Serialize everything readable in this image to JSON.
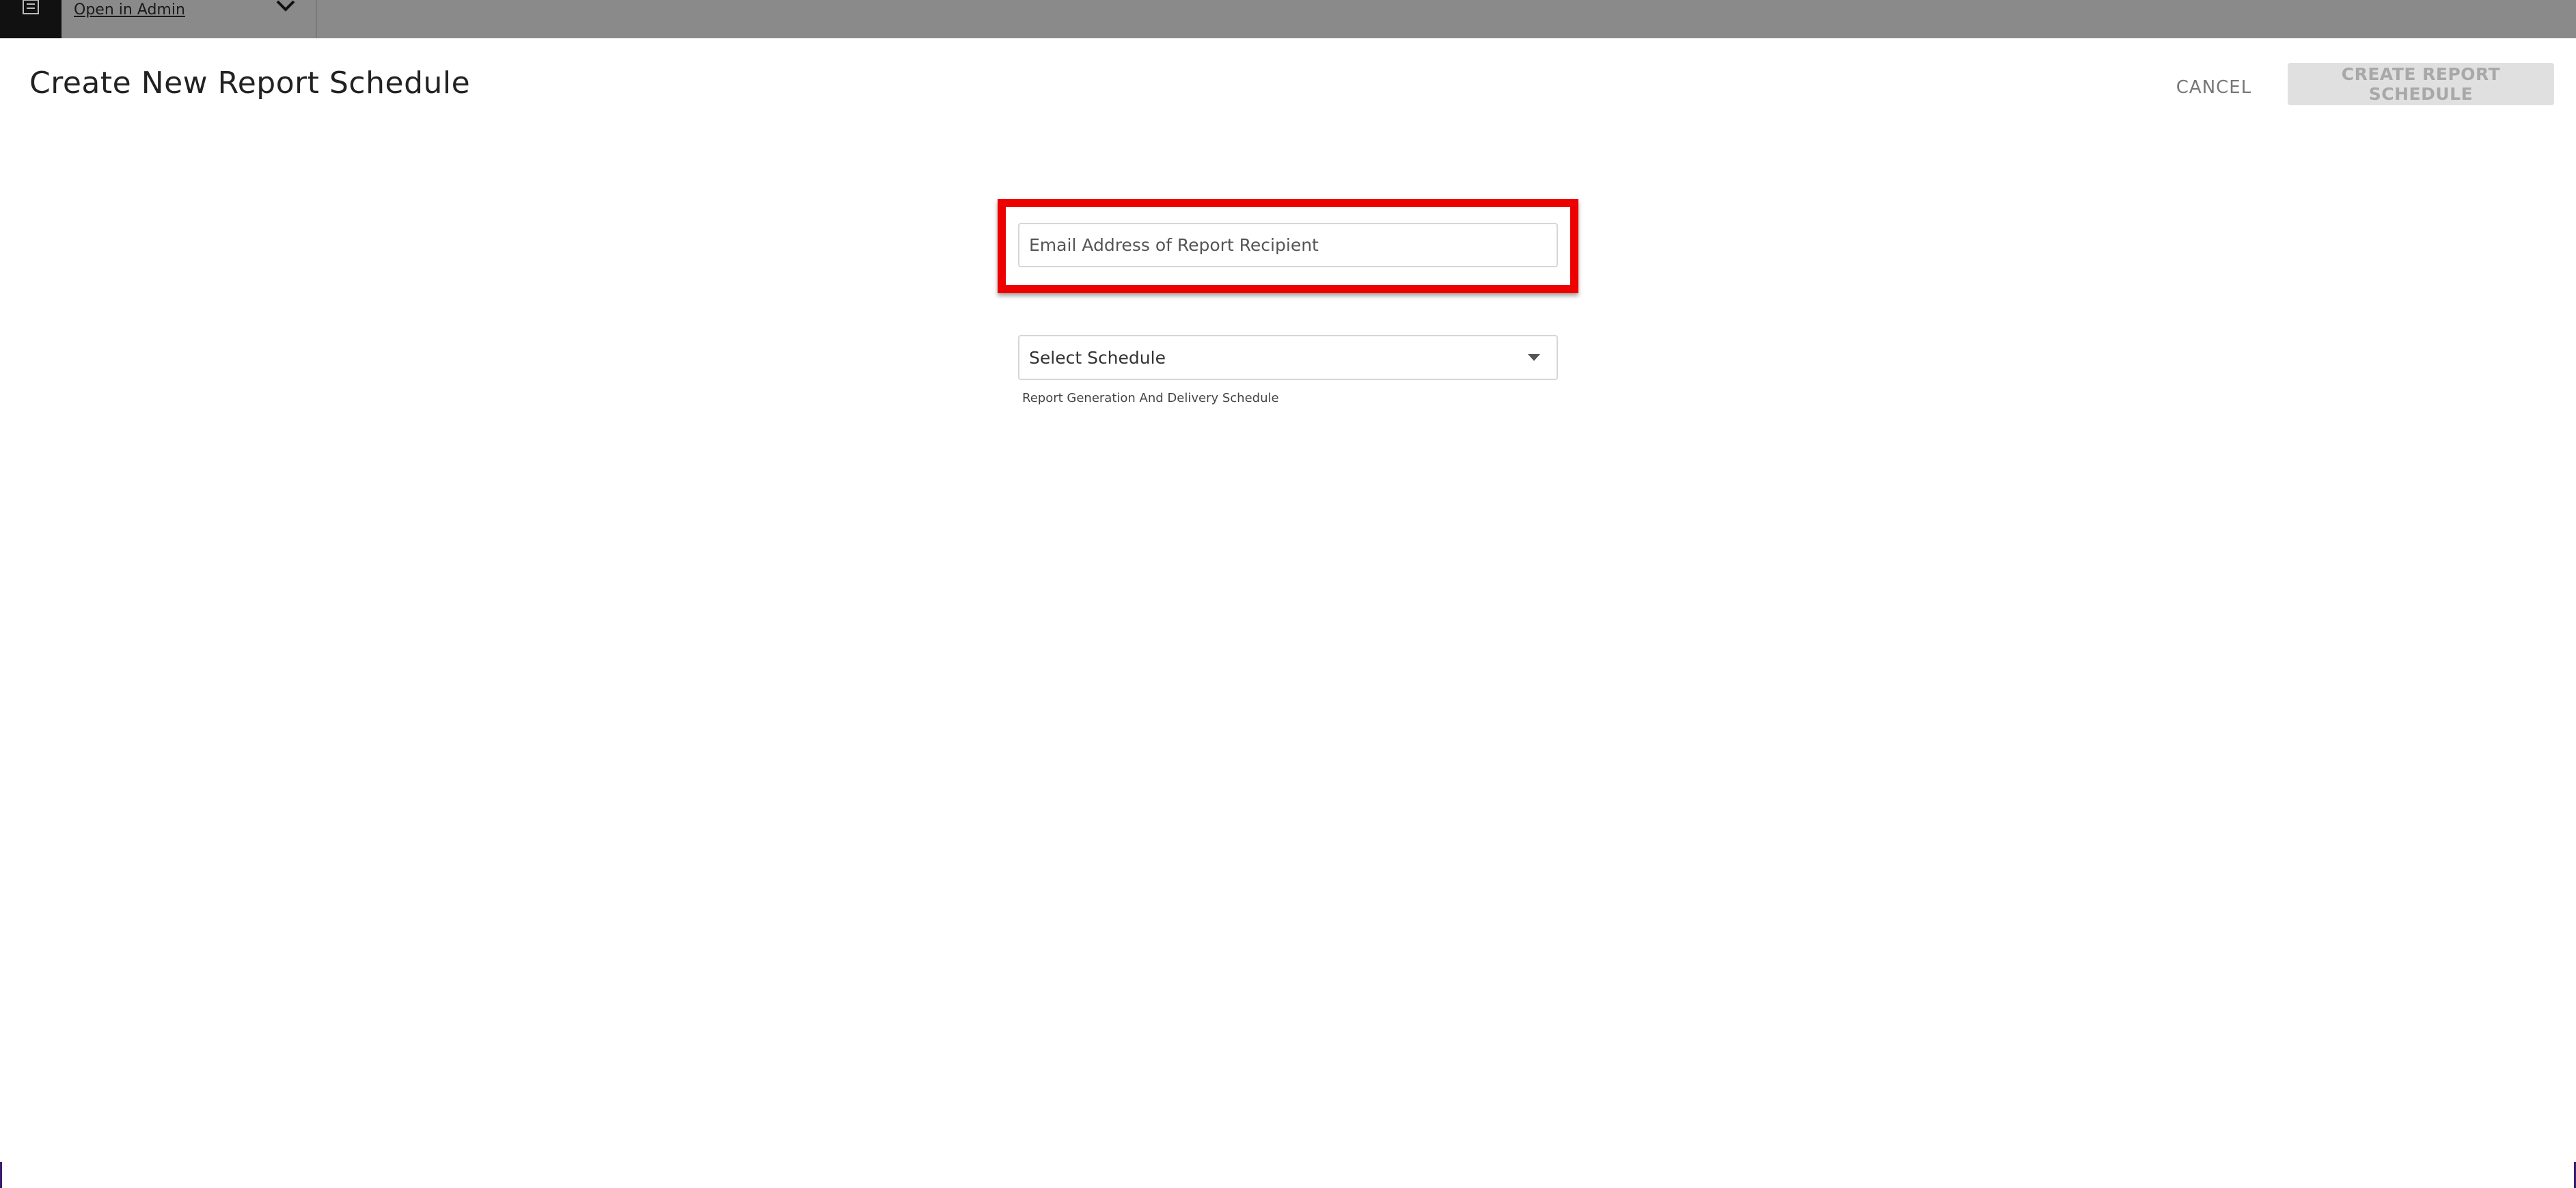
{
  "topbar": {
    "admin_link": "Open in Admin"
  },
  "modal": {
    "title": "Create New Report Schedule",
    "cancel_label": "CANCEL",
    "create_label": "CREATE REPORT SCHEDULE"
  },
  "form": {
    "email_placeholder": "Email Address of Report Recipient",
    "email_value": "",
    "schedule_selected": "Select Schedule",
    "schedule_helper": "Report Generation And Delivery Schedule"
  },
  "colors": {
    "highlight": "#ee0000",
    "disabled_button_bg": "#e0e0e0",
    "disabled_button_text": "#a8a8a8"
  },
  "icons": {
    "logo": "building-icon",
    "topbar_chevron": "chevron-down-icon",
    "select_caret": "caret-down-icon"
  }
}
